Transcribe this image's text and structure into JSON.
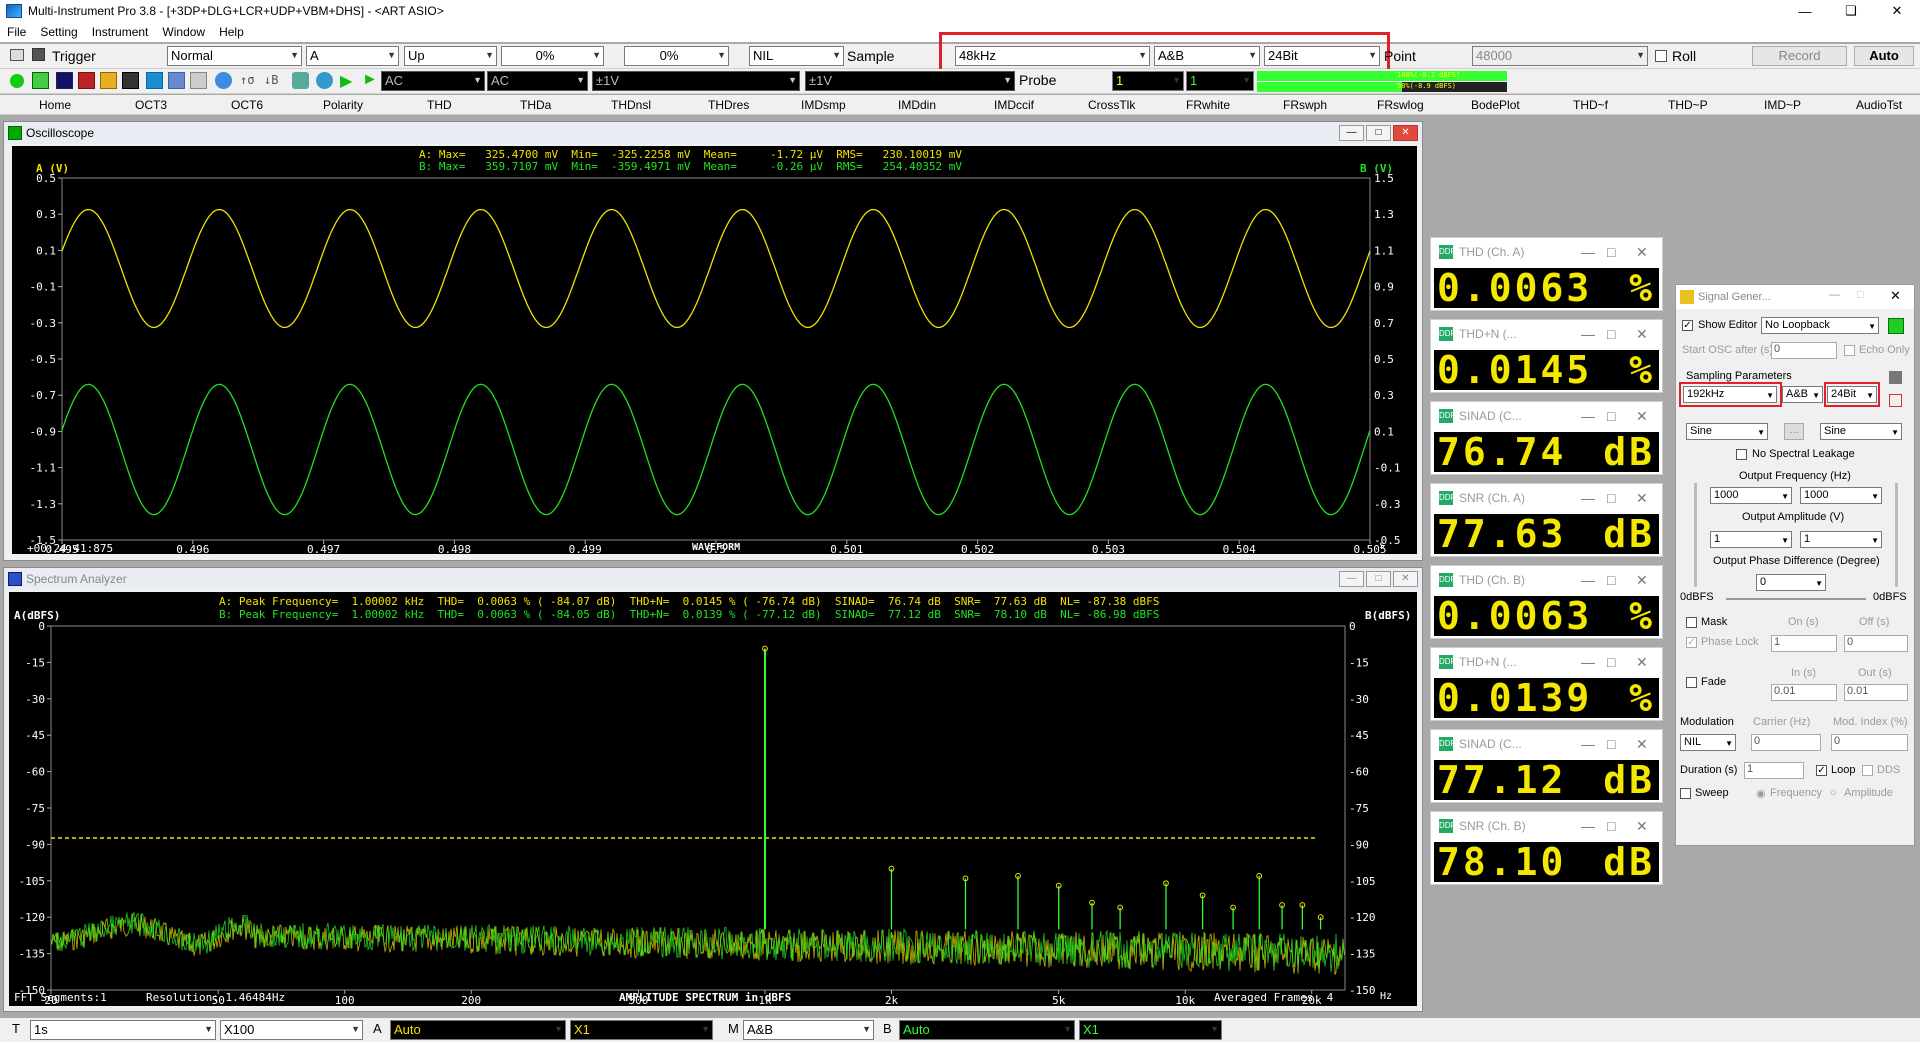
{
  "app": {
    "title": "Multi-Instrument Pro 3.8   -   [+3DP+DLG+LCR+UDP+VBM+DHS]   -   <ART ASIO>",
    "menu": [
      "File",
      "Setting",
      "Instrument",
      "Window",
      "Help"
    ]
  },
  "toolbar1": {
    "trigger_label": "Trigger",
    "trigger_mode": "Normal",
    "trigger_channel": "A",
    "trigger_edge": "Up",
    "trigger_level": "0%",
    "trigger_delay": "0%",
    "nil_select": "NIL",
    "sample_label": "Sample",
    "sample_rate": "48kHz",
    "channels": "A&B",
    "bit_depth": "24Bit",
    "point_label": "Point",
    "points": "48000",
    "roll_label": "Roll",
    "record_label": "Record",
    "auto_label": "Auto"
  },
  "toolbar2": {
    "coupling_a": "AC",
    "coupling_b": "AC",
    "range_a": "±1V",
    "range_b": "±1V",
    "probe_label": "Probe",
    "probe_a": "1",
    "probe_b": "1",
    "level_a_text": "100%(-0.1 dBFS)",
    "level_b_text": "58%(-8.9 dBFS)",
    "level_a": 1.0,
    "level_b": 0.58
  },
  "tabs": [
    "Home",
    "OCT3",
    "OCT6",
    "Polarity",
    "THD",
    "THDa",
    "THDnsl",
    "THDres",
    "IMDsmp",
    "IMDdin",
    "IMDccif",
    "CrossTlk",
    "FRwhite",
    "FRswph",
    "FRswlog",
    "BodePlot",
    "THD~f",
    "THD~P",
    "IMD~P",
    "AudioTst"
  ],
  "oscilloscope": {
    "title": "Oscilloscope",
    "stats_a": "A: Max=   325.4700 mV  Min=  -325.2258 mV  Mean=     -1.72 µV  RMS=   230.10019 mV",
    "stats_b": "B: Max=   359.7107 mV  Min=  -359.4971 mV  Mean=     -0.26 µV  RMS=   254.40352 mV",
    "ylabel_a": "A (V)",
    "ylabel_b": "B (V)",
    "yticks_a": [
      "0.5",
      "0.3",
      "0.1",
      "-0.1",
      "-0.3",
      "-0.5",
      "-0.7",
      "-0.9",
      "-1.1",
      "-1.3",
      "-1.5"
    ],
    "yticks_b": [
      "1.5",
      "1.3",
      "1.1",
      "0.9",
      "0.7",
      "0.5",
      "0.3",
      "0.1",
      "-0.1",
      "-0.3",
      "-0.5"
    ],
    "xticks": [
      "0.495",
      "0.496",
      "0.497",
      "0.498",
      "0.499",
      "0.5",
      "0.501",
      "0.502",
      "0.503",
      "0.504",
      "0.505"
    ],
    "time_label": "+00:24:41:875",
    "xlabel": "WAVEFORM",
    "xunit": "s"
  },
  "spectrum": {
    "title": "Spectrum Analyzer",
    "stats_a": "A: Peak Frequency=  1.00002 kHz  THD=  0.0063 % ( -84.07 dB)  THD+N=  0.0145 % ( -76.74 dB)  SINAD=  76.74 dB  SNR=  77.63 dB  NL= -87.38 dBFS",
    "stats_b": "B: Peak Frequency=  1.00002 kHz  THD=  0.0063 % ( -84.05 dB)  THD+N=  0.0139 % ( -77.12 dB)  SINAD=  77.12 dB  SNR=  78.10 dB  NL= -86.98 dBFS",
    "ylabel_a": "A(dBFS)",
    "ylabel_b": "B(dBFS)",
    "yticks": [
      "0",
      "-15",
      "-30",
      "-45",
      "-60",
      "-75",
      "-90",
      "-105",
      "-120",
      "-135",
      "-150"
    ],
    "xticks": [
      "20",
      "50",
      "100",
      "200",
      "500",
      "1k",
      "2k",
      "5k",
      "10k",
      "20k"
    ],
    "xunit": "Hz",
    "fft_segments": "FFT Segments:1",
    "resolution": "Resolution: 1.46484Hz",
    "xlabel": "AMPLITUDE SPECTRUM in dBFS",
    "averaged": "Averaged Frames: 4"
  },
  "chart_data": [
    {
      "type": "line",
      "title": "",
      "xlabel": "WAVEFORM",
      "ylabel": "A (V)",
      "xlim": [
        0.495,
        0.505
      ],
      "ylim": [
        -1.5,
        0.5
      ],
      "series": [
        {
          "name": "A",
          "frequency_hz": 1000,
          "amplitude": 0.3255,
          "offset": 0,
          "color": "#f2e200"
        },
        {
          "name": "B",
          "frequency_hz": 1000,
          "amplitude": 0.3597,
          "offset": -1.0,
          "color": "#22e022"
        }
      ]
    },
    {
      "type": "line",
      "title": "",
      "xlabel": "AMPLITUDE SPECTRUM in dBFS",
      "ylabel": "A(dBFS)",
      "xscale": "log",
      "xlim": [
        20,
        24000
      ],
      "ylim": [
        -150,
        0
      ],
      "noise_floor_dbfs": -125,
      "dashed_line_dbfs": -87.38,
      "peaks": [
        {
          "freq": 1000,
          "dbfs": -9.3
        },
        {
          "freq": 2000,
          "dbfs": -100
        },
        {
          "freq": 3000,
          "dbfs": -104
        },
        {
          "freq": 4000,
          "dbfs": -103
        },
        {
          "freq": 5000,
          "dbfs": -107
        },
        {
          "freq": 6000,
          "dbfs": -114
        },
        {
          "freq": 7000,
          "dbfs": -116
        },
        {
          "freq": 9000,
          "dbfs": -106
        },
        {
          "freq": 11000,
          "dbfs": -111
        },
        {
          "freq": 13000,
          "dbfs": -116
        },
        {
          "freq": 15000,
          "dbfs": -103
        },
        {
          "freq": 17000,
          "dbfs": -115
        },
        {
          "freq": 19000,
          "dbfs": -115
        },
        {
          "freq": 21000,
          "dbfs": -120
        }
      ]
    }
  ],
  "meters": [
    {
      "title": "THD (Ch. A)",
      "value": "0.0063",
      "unit": "%"
    },
    {
      "title": "THD+N (...",
      "value": "0.0145",
      "unit": "%"
    },
    {
      "title": "SINAD (C...",
      "value": "76.74",
      "unit": "dB"
    },
    {
      "title": "SNR (Ch. A)",
      "value": "77.63",
      "unit": "dB"
    },
    {
      "title": "THD (Ch. B)",
      "value": "0.0063",
      "unit": "%"
    },
    {
      "title": "THD+N (...",
      "value": "0.0139",
      "unit": "%"
    },
    {
      "title": "SINAD (C...",
      "value": "77.12",
      "unit": "dB"
    },
    {
      "title": "SNR (Ch. B)",
      "value": "78.10",
      "unit": "dB"
    }
  ],
  "siggen": {
    "title": "Signal Gener...",
    "show_editor": "Show Editor",
    "loopback": "No Loopback",
    "start_osc": "Start OSC after (s)",
    "start_osc_val": "0",
    "echo_only": "Echo Only",
    "sampling_params": "Sampling Parameters",
    "rate": "192kHz",
    "channels": "A&B",
    "bits": "24Bit",
    "wave_a": "Sine",
    "wave_b": "Sine",
    "more": "...",
    "no_leakage": "No Spectral Leakage",
    "out_freq_label": "Output Frequency (Hz)",
    "freq_a": "1000",
    "freq_b": "1000",
    "out_amp_label": "Output Amplitude (V)",
    "amp_a": "1",
    "amp_b": "1",
    "phase_label": "Output Phase Difference (Degree)",
    "phase": "0",
    "level_left": "0dBFS",
    "level_right": "0dBFS",
    "mask": "Mask",
    "on_s": "On (s)",
    "off_s": "Off (s)",
    "phase_lock": "Phase Lock",
    "on_val": "1",
    "off_val": "0",
    "fade": "Fade",
    "in_s": "In (s)",
    "out_s": "Out (s)",
    "in_val": "0.01",
    "out_val": "0.01",
    "modulation": "Modulation",
    "carrier": "Carrier (Hz)",
    "mod_index": "Mod. Index (%)",
    "mod_type": "NIL",
    "carrier_val": "0",
    "mod_val": "0",
    "duration": "Duration (s)",
    "duration_val": "1",
    "loop": "Loop",
    "dds": "DDS",
    "sweep": "Sweep",
    "frequency": "Frequency",
    "amplitude": "Amplitude"
  },
  "bottombar": {
    "t_label": "T",
    "time": "1s",
    "zoom": "X100",
    "a_label": "A",
    "a_mode": "Auto",
    "a_zoom": "X1",
    "m_label": "M",
    "m_mode": "A&B",
    "b_label": "B",
    "b_mode": "Auto",
    "b_zoom": "X1"
  }
}
